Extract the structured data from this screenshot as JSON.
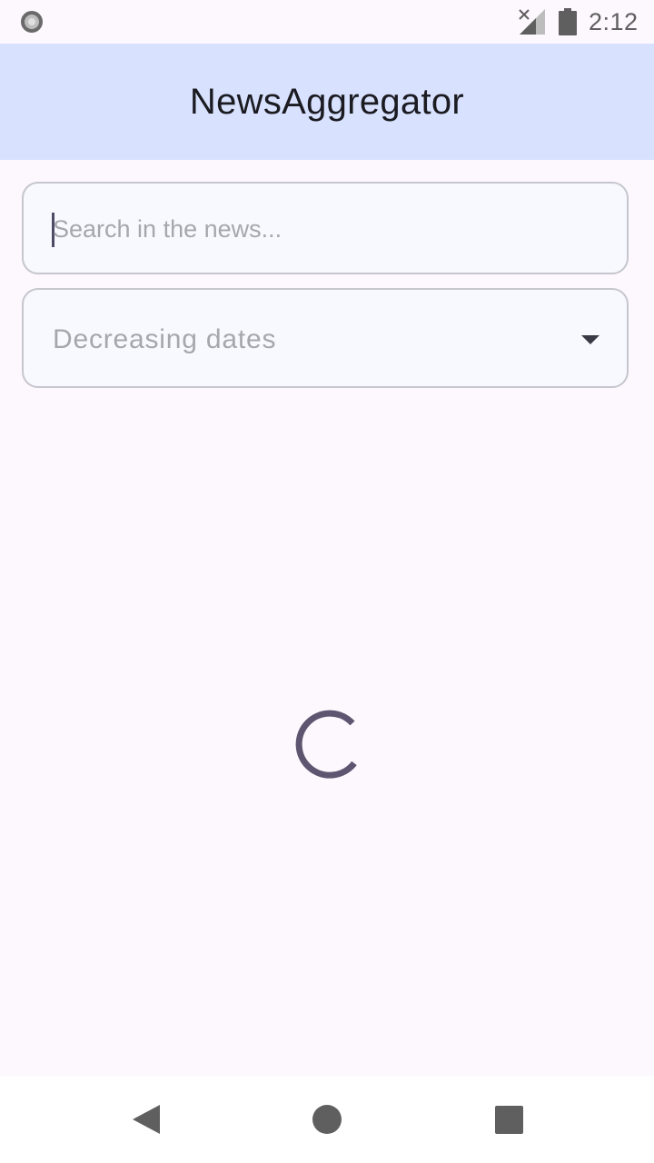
{
  "status_bar": {
    "time": "2:12",
    "left_icon": "record-icon",
    "signal_icon": "signal-off-icon",
    "battery_icon": "battery-icon"
  },
  "app_bar": {
    "title": "NewsAggregator",
    "background": "#d8e2ff"
  },
  "search": {
    "placeholder": "Search in the news...",
    "value": ""
  },
  "sort": {
    "selected": "Decreasing dates",
    "icon": "dropdown-arrow-icon"
  },
  "loading": {
    "icon": "loading-spinner-icon",
    "color": "#5e5670"
  },
  "nav_bar": {
    "back_icon": "back-icon",
    "home_icon": "home-icon",
    "recents_icon": "recents-icon"
  }
}
